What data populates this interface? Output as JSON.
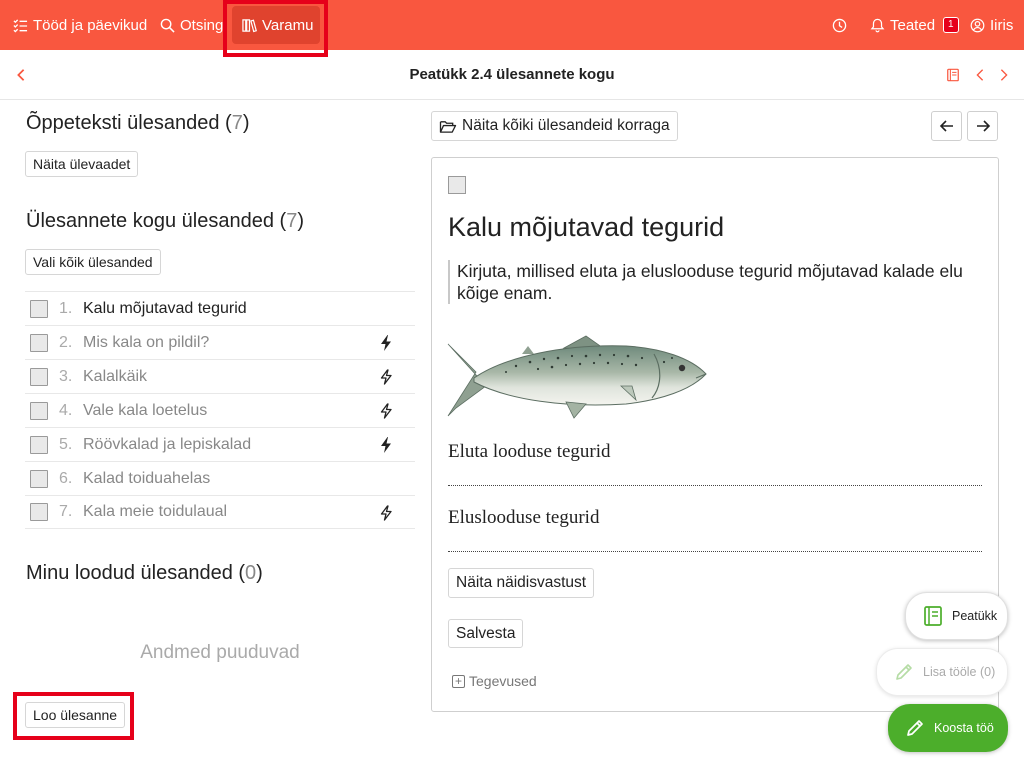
{
  "nav": {
    "items": [
      {
        "label": "Tööd ja päevikud",
        "icon": "list-check-icon"
      },
      {
        "label": "Otsing",
        "icon": "search-icon"
      },
      {
        "label": "Varamu",
        "icon": "library-icon",
        "active": true
      }
    ],
    "notifications_label": "Teated",
    "notifications_count": "1",
    "user_label": "Iiris",
    "accent_color": "#f9573f"
  },
  "header": {
    "title": "Peatükk 2.4 ülesannete kogu"
  },
  "left": {
    "section1": {
      "title": "Õppeteksti ülesanded (",
      "count": "7",
      "close": ")",
      "button": "Näita ülevaadet"
    },
    "section2": {
      "title": "Ülesannete kogu ülesanded (",
      "count": "7",
      "close": ")",
      "button": "Vali kõik ülesanded"
    },
    "tasks": [
      {
        "num": "1.",
        "label": "Kalu mõjutavad tegurid",
        "bolt": "none"
      },
      {
        "num": "2.",
        "label": "Mis kala on pildil?",
        "bolt": "filled"
      },
      {
        "num": "3.",
        "label": "Kalalkäik",
        "bolt": "outline"
      },
      {
        "num": "4.",
        "label": "Vale kala loetelus",
        "bolt": "outline"
      },
      {
        "num": "5.",
        "label": "Röövkalad ja lepiskalad",
        "bolt": "filled"
      },
      {
        "num": "6.",
        "label": "Kalad toiduahelas",
        "bolt": "none"
      },
      {
        "num": "7.",
        "label": "Kala meie toidulaual",
        "bolt": "outline"
      }
    ],
    "section3": {
      "title": "Minu loodud ülesanded (",
      "count": "0",
      "close": ")"
    },
    "empty_text": "Andmed puuduvad",
    "create_button": "Loo ülesanne"
  },
  "right": {
    "show_all_button": "Näita kõiki ülesandeid korraga",
    "card": {
      "title": "Kalu mõjutavad tegurid",
      "instruction": "Kirjuta, millised eluta ja elusloodusе tegurid mõjutavad kalade elu kõige enam.",
      "field1_label": "Eluta looduse tegurid",
      "field2_label": "Elusloodusе tegurid",
      "sample_answer_button": "Näita näidisvastust",
      "save_button": "Salvesta",
      "actions_label": "Tegevused"
    }
  },
  "fabs": {
    "chapter": "Peatükk",
    "add_to_work": "Lisa tööle (0)",
    "compose_work": "Koosta töö",
    "compose_color": "#4cae2b"
  }
}
